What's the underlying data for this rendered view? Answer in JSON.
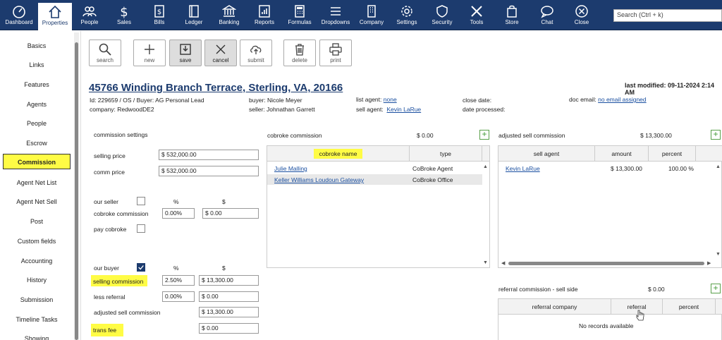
{
  "topnav": {
    "items": [
      {
        "label": "Dashboard",
        "icon": "dashboard-icon"
      },
      {
        "label": "Properties",
        "icon": "home-icon"
      },
      {
        "label": "People",
        "icon": "people-icon"
      },
      {
        "label": "Sales",
        "icon": "dollar-icon"
      },
      {
        "label": "Bills",
        "icon": "bills-icon"
      },
      {
        "label": "Ledger",
        "icon": "ledger-icon"
      },
      {
        "label": "Banking",
        "icon": "bank-icon"
      },
      {
        "label": "Reports",
        "icon": "reports-icon"
      },
      {
        "label": "Formulas",
        "icon": "calculator-icon"
      },
      {
        "label": "Dropdowns",
        "icon": "menu-icon"
      },
      {
        "label": "Company",
        "icon": "building-icon"
      },
      {
        "label": "Settings",
        "icon": "gear-icon"
      },
      {
        "label": "Security",
        "icon": "shield-icon"
      },
      {
        "label": "Tools",
        "icon": "tools-icon"
      },
      {
        "label": "Store",
        "icon": "bag-icon"
      },
      {
        "label": "Chat",
        "icon": "chat-icon"
      },
      {
        "label": "Close",
        "icon": "close-icon"
      }
    ],
    "search_placeholder": "Search (Ctrl + k)"
  },
  "sidebar": {
    "items": [
      "Basics",
      "Links",
      "Features",
      "Agents",
      "People",
      "Escrow",
      "Commission",
      "Agent Net List",
      "Agent Net Sell",
      "Post",
      "Custom fields",
      "Accounting",
      "History",
      "Submission",
      "Timeline Tasks",
      "Showing"
    ],
    "active": "Commission"
  },
  "toolbar": {
    "search": "search",
    "new": "new",
    "save": "save",
    "cancel": "cancel",
    "submit": "submit",
    "delete": "delete",
    "print": "print"
  },
  "property": {
    "address": "45766 Winding Branch Terrace, Sterling, VA, 20166",
    "last_modified": "last modified: 09-11-2024 2:14 AM",
    "id_line": "Id: 229659 / OS / Buyer: AG Personal Lead",
    "company": "company: RedwoodDE2",
    "buyer": "buyer: Nicole Meyer",
    "seller": "seller: Johnathan Garrett",
    "list_agent_label": "list agent:",
    "list_agent": "none",
    "sell_agent_label": "sell agent:",
    "sell_agent": "Kevin LaRue",
    "close_date": "close date:",
    "date_processed": "date processed:",
    "doc_email_label": "doc email:",
    "doc_email": "no email assigned"
  },
  "commission_settings": {
    "title": "commission settings",
    "selling_price_label": "selling price",
    "selling_price": "$ 532,000.00",
    "comm_price_label": "comm price",
    "comm_price": "$ 532,000.00",
    "our_seller_label": "our seller",
    "pct_header": "%",
    "dollar_header": "$",
    "cobroke_commission_label": "cobroke commission",
    "cobroke_pct": "0.00%",
    "cobroke_amt": "$ 0.00",
    "pay_cobroke_label": "pay cobroke",
    "our_buyer_label": "our buyer",
    "selling_commission_label": "selling commission",
    "selling_commission_pct": "2.50%",
    "selling_commission_amt": "$ 13,300.00",
    "less_referral_label": "less referral",
    "less_referral_pct": "0.00%",
    "less_referral_amt": "$ 0.00",
    "adjusted_sell_commission_label": "adjusted sell commission",
    "adjusted_sell_commission_amt": "$ 13,300.00",
    "trans_fee_label": "trans fee",
    "trans_fee_amt": "$ 0.00"
  },
  "cobroke": {
    "title": "cobroke commission",
    "total": "$ 0.00",
    "headers": [
      "cobroke name",
      "type"
    ],
    "rows": [
      {
        "name": "Julie Malling",
        "type": "CoBroke Agent"
      },
      {
        "name": "Keller Williams Loudoun Gateway",
        "type": "CoBroke Office"
      }
    ]
  },
  "adjusted_sell": {
    "title": "adjusted sell commission",
    "total": "$ 13,300.00",
    "headers": [
      "sell agent",
      "amount",
      "percent"
    ],
    "rows": [
      {
        "agent": "Kevin LaRue",
        "amount": "$ 13,300.00",
        "percent": "100.00 %"
      }
    ]
  },
  "referral": {
    "title": "referral commission - sell side",
    "total": "$ 0.00",
    "headers": [
      "referral company",
      "referral",
      "percent"
    ],
    "empty": "No records available"
  },
  "colors": {
    "nav_bg": "#1c3b6e",
    "highlight": "#fffc45",
    "link": "#1a4fa0"
  }
}
